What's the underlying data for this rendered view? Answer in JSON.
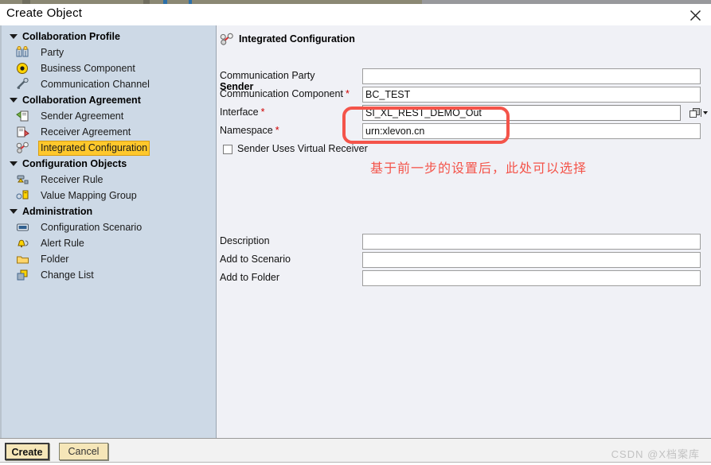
{
  "window": {
    "title": "Create Object",
    "close_icon": "close-icon"
  },
  "sidebar": {
    "groups": [
      {
        "label": "Collaboration Profile",
        "items": [
          {
            "label": "Party",
            "icon": "party-icon",
            "selected": false
          },
          {
            "label": "Business Component",
            "icon": "business-component-icon",
            "selected": false
          },
          {
            "label": "Communication Channel",
            "icon": "communication-channel-icon",
            "selected": false
          }
        ]
      },
      {
        "label": "Collaboration Agreement",
        "items": [
          {
            "label": "Sender Agreement",
            "icon": "sender-agreement-icon",
            "selected": false
          },
          {
            "label": "Receiver Agreement",
            "icon": "receiver-agreement-icon",
            "selected": false
          },
          {
            "label": "Integrated Configuration",
            "icon": "integrated-configuration-icon",
            "selected": true
          }
        ]
      },
      {
        "label": "Configuration Objects",
        "items": [
          {
            "label": "Receiver Rule",
            "icon": "receiver-rule-icon",
            "selected": false
          },
          {
            "label": "Value Mapping Group",
            "icon": "value-mapping-group-icon",
            "selected": false
          }
        ]
      },
      {
        "label": "Administration",
        "items": [
          {
            "label": "Configuration Scenario",
            "icon": "configuration-scenario-icon",
            "selected": false
          },
          {
            "label": "Alert Rule",
            "icon": "alert-rule-icon",
            "selected": false
          },
          {
            "label": "Folder",
            "icon": "folder-icon",
            "selected": false
          },
          {
            "label": "Change List",
            "icon": "change-list-icon",
            "selected": false
          }
        ]
      }
    ]
  },
  "main": {
    "panel_title": "Integrated Configuration",
    "panel_icon": "integrated-configuration-icon",
    "section_sender": "Sender",
    "fields": {
      "communication_party": {
        "label": "Communication Party",
        "required": false,
        "value": ""
      },
      "communication_component": {
        "label": "Communication Component",
        "required": true,
        "value": "BC_TEST"
      },
      "interface": {
        "label": "Interface",
        "required": true,
        "value": "SI_XL_REST_DEMO_Out",
        "value_help_icon": "value-help-icon"
      },
      "namespace": {
        "label": "Namespace",
        "required": true,
        "value": "urn:xlevon.cn"
      },
      "description": {
        "label": "Description",
        "required": false,
        "value": ""
      },
      "add_to_scenario": {
        "label": "Add to Scenario",
        "required": false,
        "value": ""
      },
      "add_to_folder": {
        "label": "Add to Folder",
        "required": false,
        "value": ""
      }
    },
    "checkbox": {
      "label": "Sender Uses Virtual Receiver",
      "checked": false
    },
    "required_marker": "*"
  },
  "annotation": {
    "note_text": "基于前一步的设置后，此处可以选择",
    "highlight_color": "#f4544a"
  },
  "footer": {
    "create_label": "Create",
    "cancel_label": "Cancel",
    "watermark": "CSDN @X档案库"
  }
}
